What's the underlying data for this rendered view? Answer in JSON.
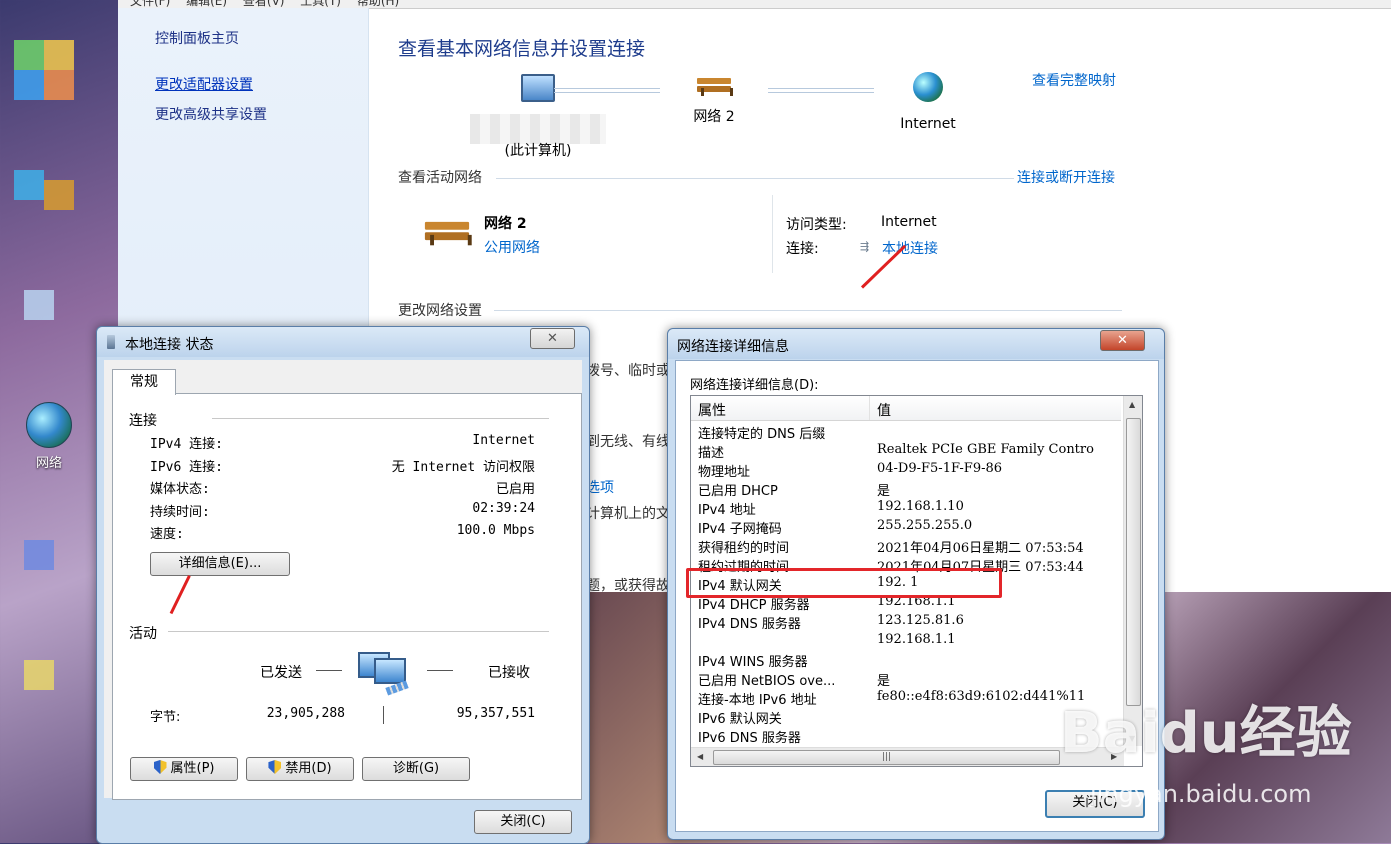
{
  "menubar": [
    "文件(F)",
    "编辑(E)",
    "查看(V)",
    "工具(T)",
    "帮助(H)"
  ],
  "desktop": {
    "network_icon_label": "网络"
  },
  "left_panel": {
    "home": "控制面板主页",
    "links": [
      "更改适配器设置",
      "更改高级共享设置"
    ]
  },
  "main": {
    "title": "查看基本网络信息并设置连接",
    "view_full_map": "查看完整映射",
    "nodes": {
      "computer_label": "(此计算机)",
      "network_label": "网络  2",
      "internet_label": "Internet"
    },
    "active_networks_head": "查看活动网络",
    "connect_disconnect": "连接或断开连接",
    "network_name": "网络  2",
    "network_type": "公用网络",
    "access_type_label": "访问类型:",
    "access_type_value": "Internet",
    "connection_label": "连接:",
    "connection_value": "本地连接",
    "change_settings_head": "更改网络设置",
    "behind_text": [
      "拨号、临时或",
      "到无线、有线",
      "选项",
      "计算机上的文",
      "题，或获得故"
    ]
  },
  "status_dialog": {
    "title": "本地连接 状态",
    "tab": "常规",
    "connection_group": "连接",
    "rows": [
      {
        "label": "IPv4 连接:",
        "value": "Internet"
      },
      {
        "label": "IPv6 连接:",
        "value": "无 Internet 访问权限"
      },
      {
        "label": "媒体状态:",
        "value": "已启用"
      },
      {
        "label": "持续时间:",
        "value": "02:39:24"
      },
      {
        "label": "速度:",
        "value": "100.0 Mbps"
      }
    ],
    "details_button": "详细信息(E)...",
    "activity_group": "活动",
    "sent_label": "已发送",
    "received_label": "已接收",
    "bytes_label": "字节:",
    "bytes_sent": "23,905,288",
    "bytes_received": "95,357,551",
    "properties_button": "属性(P)",
    "disable_button": "禁用(D)",
    "diagnose_button": "诊断(G)",
    "close_button": "关闭(C)"
  },
  "details_dialog": {
    "title": "网络连接详细信息",
    "subtitle": "网络连接详细信息(D):",
    "col_property": "属性",
    "col_value": "值",
    "rows": [
      {
        "p": "连接特定的 DNS 后缀",
        "v": ""
      },
      {
        "p": "描述",
        "v": "Realtek PCIe GBE Family Contro"
      },
      {
        "p": "物理地址",
        "v": "04-D9-F5-1F-F9-86"
      },
      {
        "p": "已启用 DHCP",
        "v": "是"
      },
      {
        "p": "IPv4 地址",
        "v": "192.168.1.10"
      },
      {
        "p": "IPv4 子网掩码",
        "v": "255.255.255.0"
      },
      {
        "p": "获得租约的时间",
        "v": "2021年04月06日星期二 07:53:54"
      },
      {
        "p": "租约过期的时间",
        "v": "2021年04月07日星期三 07:53:44"
      },
      {
        "p": "IPv4 默认网关",
        "v": "192.    1"
      },
      {
        "p": "IPv4 DHCP 服务器",
        "v": "192.168.1.1"
      },
      {
        "p": "IPv4 DNS 服务器",
        "v": "123.125.81.6"
      },
      {
        "p": "",
        "v": "192.168.1.1"
      },
      {
        "p": "IPv4 WINS 服务器",
        "v": ""
      },
      {
        "p": "已启用 NetBIOS ove...",
        "v": "是"
      },
      {
        "p": "连接-本地 IPv6 地址",
        "v": "fe80::e4f8:63d9:6102:d441%11"
      },
      {
        "p": "IPv6 默认网关",
        "v": ""
      },
      {
        "p": "IPv6 DNS 服务器",
        "v": ""
      }
    ],
    "close_button": "关闭(C)"
  },
  "watermark": {
    "logo": "Baidu经验",
    "url": "jingyan.baidu.com"
  }
}
